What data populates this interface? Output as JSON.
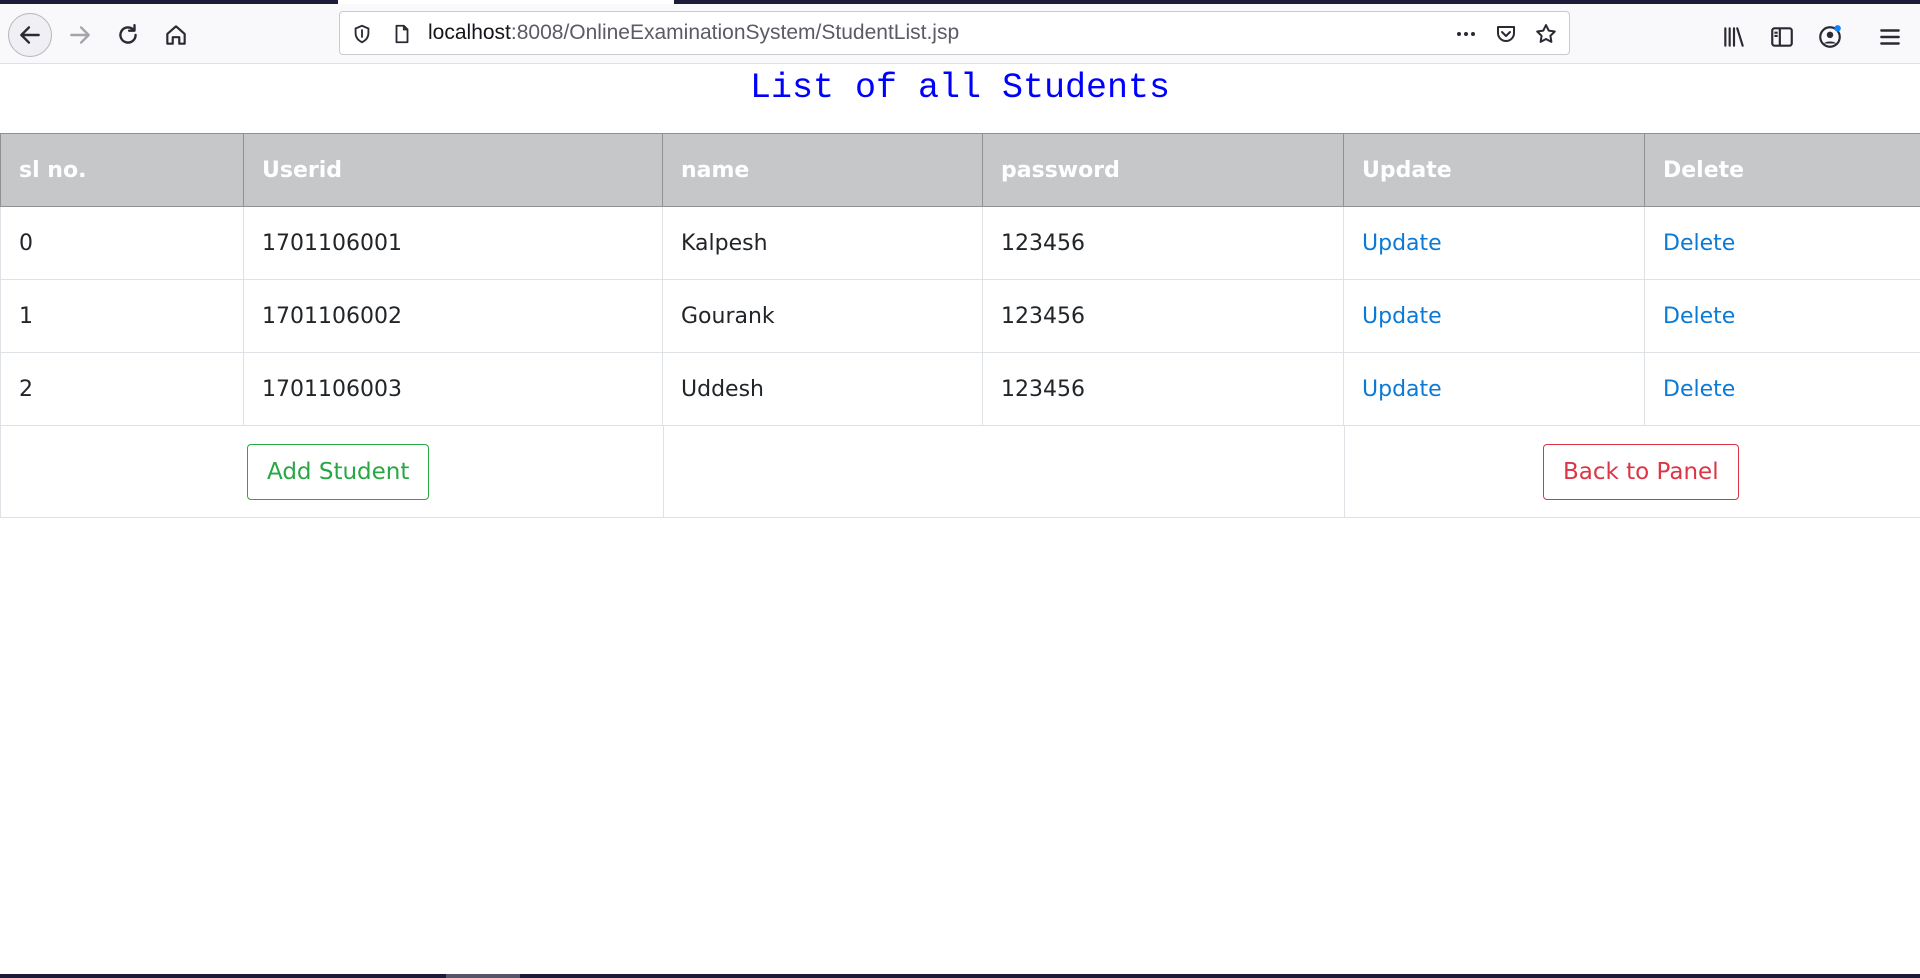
{
  "browser": {
    "url_host": "localhost",
    "url_path": ":8008/OnlineExaminationSystem/StudentList.jsp"
  },
  "page": {
    "title": "List of all Students"
  },
  "table": {
    "headers": [
      "sl no.",
      "Userid",
      "name",
      "password",
      "Update",
      "Delete"
    ],
    "rows": [
      {
        "sl": "0",
        "userid": "1701106001",
        "name": "Kalpesh",
        "password": "123456",
        "update": "Update",
        "delete": "Delete"
      },
      {
        "sl": "1",
        "userid": "1701106002",
        "name": "Gourank",
        "password": "123456",
        "update": "Update",
        "delete": "Delete"
      },
      {
        "sl": "2",
        "userid": "1701106003",
        "name": "Uddesh",
        "password": "123456",
        "update": "Update",
        "delete": "Delete"
      }
    ]
  },
  "buttons": {
    "add_student": "Add Student",
    "back_to_panel": "Back to Panel"
  },
  "colors": {
    "title": "#0000ff",
    "header_bg": "#c6c7c9",
    "link": "#0b7ad6",
    "success": "#28a745",
    "danger": "#dc3545"
  }
}
